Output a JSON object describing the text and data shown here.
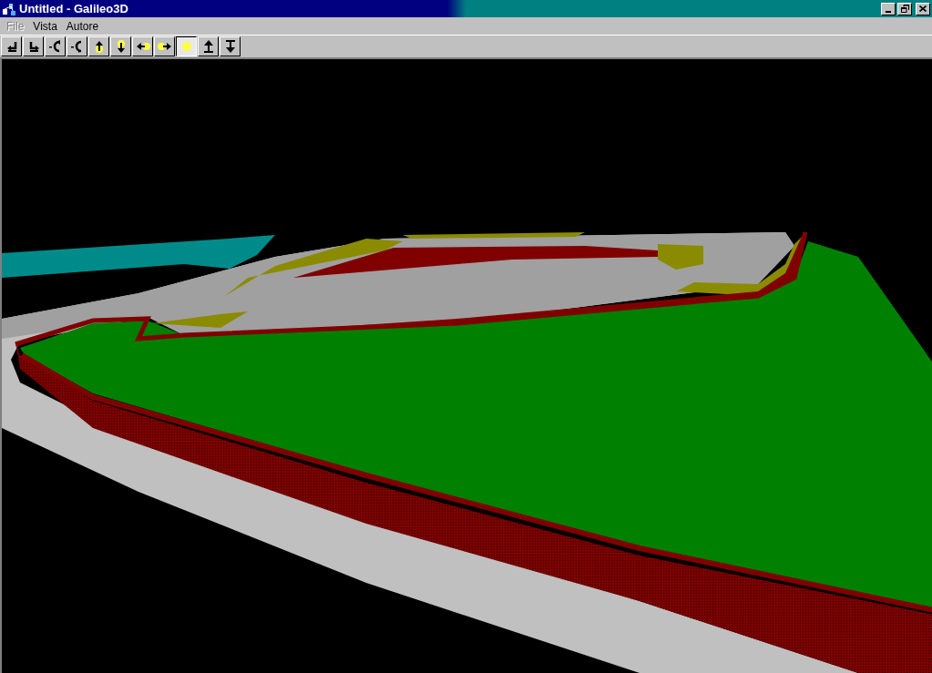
{
  "window": {
    "title": "Untitled - Galileo3D"
  },
  "menu": [
    {
      "label": "File",
      "disabled": true
    },
    {
      "label": "Vista",
      "disabled": false
    },
    {
      "label": "Autore",
      "disabled": false
    }
  ],
  "toolbar": [
    {
      "kind": "turn-left",
      "selected": false
    },
    {
      "kind": "turn-right",
      "selected": false
    },
    {
      "kind": "rotate-left",
      "selected": false
    },
    {
      "kind": "rotate-right",
      "selected": false
    },
    {
      "kind": "light-up",
      "selected": false
    },
    {
      "kind": "light-down",
      "selected": false
    },
    {
      "kind": "light-left",
      "selected": false
    },
    {
      "kind": "light-right",
      "selected": false
    },
    {
      "kind": "light",
      "selected": true
    },
    {
      "kind": "up",
      "selected": false
    },
    {
      "kind": "down",
      "selected": false
    }
  ]
}
